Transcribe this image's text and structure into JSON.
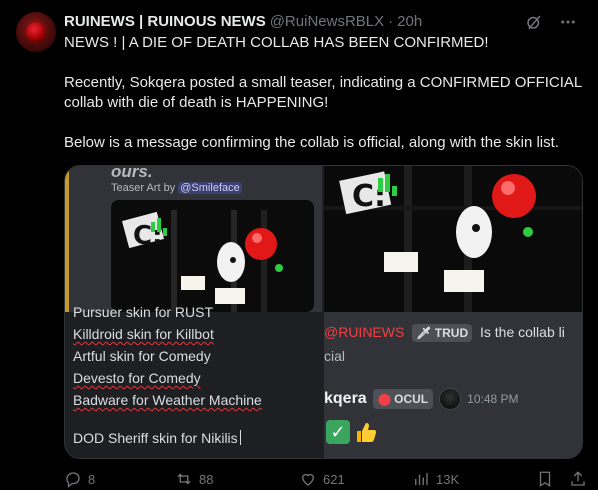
{
  "post": {
    "display_name": "RUINEWS | RUINOUS NEWS",
    "handle": "@RuiNewsRBLX",
    "separator": "·",
    "time": "20h",
    "paragraphs": [
      "NEWS ! | A DIE OF DEATH COLLAB HAS BEEN CONFIRMED!",
      "Recently, Sokqera posted a small teaser, indicating a CONFIRMED OFFICIAL collab with die of death is HAPPENING!",
      "Below is a message confirming the collab is official, along with the skin list."
    ]
  },
  "media": {
    "teaser_heading": "ours.",
    "teaser_caption": "Teaser Art by",
    "teaser_mention": "@Smileface",
    "skin_lines": [
      "Pursuer skin for RUST",
      "Killdroid skin for Killbot",
      "Artful skin for Comedy",
      "Devesto for Comedy",
      "Badware for Weather Machine",
      "DOD Sheriff skin for Nikilis"
    ],
    "chat": {
      "reply_mention": "@RUINEWS",
      "reply_tag": "TRUD",
      "reply_text": "Is the collab li",
      "line2": "cial",
      "sender": "kqera",
      "sender_tag": "OCUL",
      "msg_time": "10:48 PM",
      "reactions": [
        "white-check-mark",
        "thumbs-up"
      ]
    }
  },
  "actions": {
    "replies": "8",
    "reposts": "88",
    "likes": "621",
    "views": "13K"
  },
  "colors": {
    "background": "#000000",
    "text": "#e7e9ea",
    "muted": "#71767b",
    "discord_bg": "#313338",
    "mention_red": "#f23f43",
    "accent_gold": "#c79b2b"
  }
}
